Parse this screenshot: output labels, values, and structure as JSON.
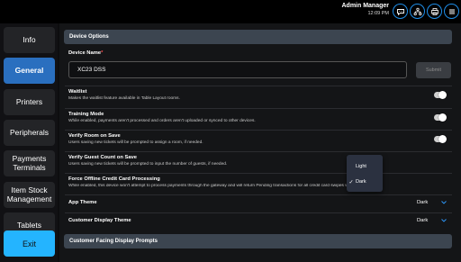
{
  "header": {
    "user_name": "Admin Manager",
    "time": "12:09 PM"
  },
  "toolbar_icons": [
    "chat-icon",
    "org-chart-icon",
    "printer-icon",
    "menu-icon"
  ],
  "sidebar": {
    "items": [
      {
        "label": "Info"
      },
      {
        "label": "General"
      },
      {
        "label": "Printers"
      },
      {
        "label": "Peripherals"
      },
      {
        "label": "Payments Terminals"
      },
      {
        "label": "Item Stock Management"
      },
      {
        "label": "Tablets"
      }
    ],
    "active": "General",
    "exit_label": "Exit"
  },
  "main": {
    "device_options": {
      "title": "Device Options",
      "device_name_label": "Device Name",
      "required_mark": "*",
      "device_name_value": "XC23 DSS",
      "submit_label": "Submit"
    },
    "settings": [
      {
        "label": "Waitlist",
        "description": "Makes the waitlist feature available in Table Layout rooms.",
        "toggle": true
      },
      {
        "label": "Training Mode",
        "description": "While enabled, payments aren't processed and orders aren't uploaded or synced to other devices.",
        "toggle": true
      },
      {
        "label": "Verify Room on Save",
        "description": "Users saving new tickets will be prompted to assign a room, if needed.",
        "toggle": true
      },
      {
        "label": "Verify Guest Count on Save",
        "description": "Users saving new tickets will be prompted to input the number of guests, if needed.",
        "toggle": false
      },
      {
        "label": "Force Offline Credit Card Processing",
        "description": "While enabled, this device won't attempt to process payments through the gateway and will return Pending transactions for all credit card swipes which must be authori",
        "toggle": false
      }
    ],
    "app_theme": {
      "label": "App Theme",
      "value": "Dark"
    },
    "customer_display_theme": {
      "label": "Customer Display Theme",
      "value": "Dark"
    },
    "customer_prompts_title": "Customer Facing Display Prompts"
  },
  "theme_dropdown": {
    "options": [
      "Light",
      "Dark"
    ],
    "selected": "Dark",
    "check": "✓"
  },
  "colors": {
    "accent": "#24b4ff",
    "active_nav": "#2a6fbf",
    "section_header": "#3c4550"
  }
}
